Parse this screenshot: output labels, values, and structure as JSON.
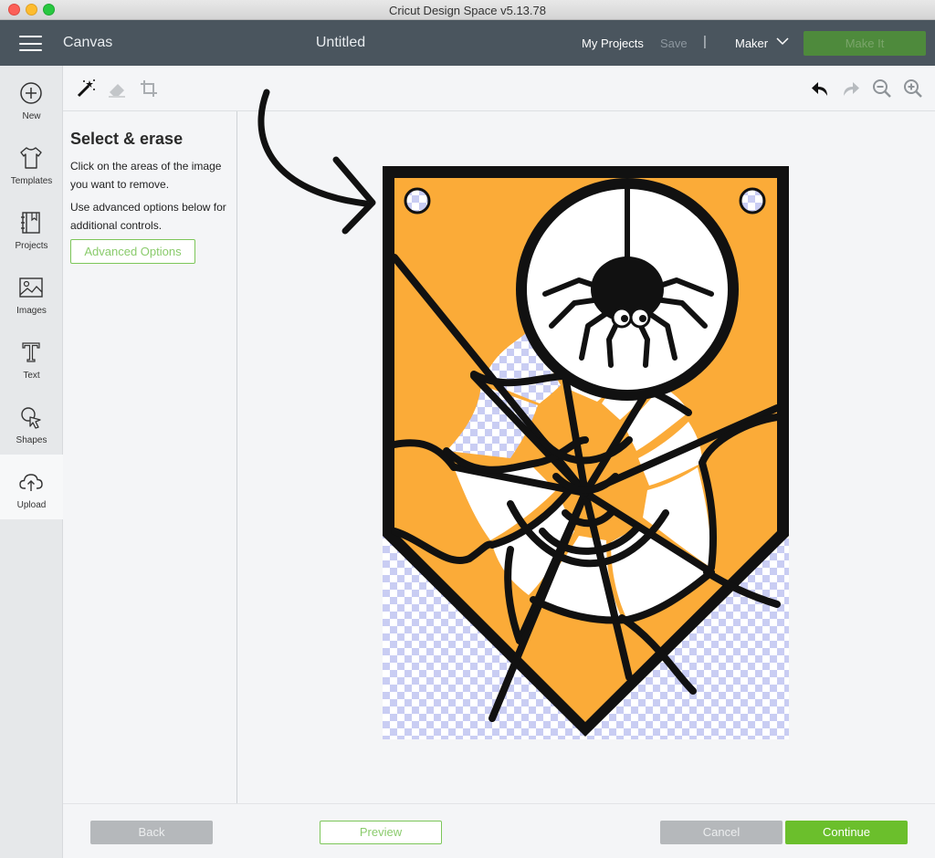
{
  "window": {
    "title": "Cricut Design Space  v5.13.78"
  },
  "header": {
    "section": "Canvas",
    "project_title": "Untitled",
    "my_projects": "My Projects",
    "save": "Save",
    "separator": "|",
    "machine": "Maker",
    "make_it": "Make It"
  },
  "sidebar": {
    "items": [
      {
        "label": "New",
        "icon": "plus-circle-icon"
      },
      {
        "label": "Templates",
        "icon": "tshirt-icon"
      },
      {
        "label": "Projects",
        "icon": "notebook-icon"
      },
      {
        "label": "Images",
        "icon": "image-icon"
      },
      {
        "label": "Text",
        "icon": "text-icon"
      },
      {
        "label": "Shapes",
        "icon": "shapes-icon"
      },
      {
        "label": "Upload",
        "icon": "upload-cloud-icon"
      }
    ],
    "active": "Upload"
  },
  "tools": {
    "left": [
      "magic-wand-icon",
      "eraser-icon",
      "crop-icon"
    ],
    "right": [
      "undo-icon",
      "redo-icon",
      "zoom-out-icon",
      "zoom-in-icon"
    ]
  },
  "panel": {
    "title": "Select & erase",
    "text1": "Click on the areas of the image you want to remove.",
    "text2": "Use advanced options below for additional controls.",
    "advanced_options": "Advanced Options"
  },
  "footer": {
    "back": "Back",
    "preview": "Preview",
    "cancel": "Cancel",
    "continue": "Continue"
  },
  "colors": {
    "header_bg": "#4a555e",
    "accent_green": "#6bbf2c",
    "artwork_orange": "#fbab38",
    "checker": "#c9cdf3"
  }
}
